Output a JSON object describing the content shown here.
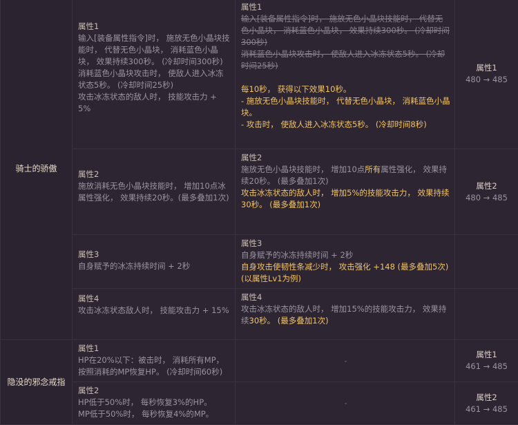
{
  "rings": [
    {
      "name": "骑士的骄傲",
      "attrs": [
        {
          "old_title": "属性1",
          "old_lines": [
            "输入[装备属性指令]时， 施放无色小晶块技能时， 代替无色小晶块， 消耗蓝色小晶块， 效果持续300秒。 (冷却时间300秒)",
            "消耗蓝色小晶块攻击时， 使敌人进入冰冻状态5秒。 (冷却时间25秒)",
            "攻击冰冻状态的敌人时， 技能攻击力 + 5%"
          ],
          "new_title": "属性1",
          "new_strike": [
            "输入[装备属性指令]时， 施放无色小晶块技能时， 代替无色小晶块， 消耗蓝色小晶块， 效果持续300秒。 (冷却时间300秒)",
            "消耗蓝色小晶块攻击时， 使敌人进入冰冻状态5秒。 (冷却时间25秒)"
          ],
          "new_hl": [
            "每10秒， 获得以下效果10秒。",
            "- 施放无色小晶块技能时， 代替无色小晶块， 消耗蓝色小晶块。",
            "- 攻击时， 使敌人进入冰冻状态5秒。 (冷却时间8秒)"
          ],
          "lv_title": "属性1",
          "lv_value": "480 → 485"
        },
        {
          "old_title": "属性2",
          "old_lines": [
            "施放消耗无色小晶块技能时， 增加10点冰属性强化， 效果持续20秒。(最多叠加1次)"
          ],
          "new_title": "属性2",
          "new_mixed_pre": "施放无色小晶块技能时， 增加10点",
          "new_mixed_hl": "所有",
          "new_mixed_post": "属性强化， 效果持续20秒。 (最多叠加1次)",
          "new_hl": [
            "攻击冰冻状态的敌人时， 增加5%的技能攻击力， 效果持续30秒。 (最多叠加1次)"
          ],
          "lv_title": "属性2",
          "lv_value": "480 → 485"
        },
        {
          "old_title": "属性3",
          "old_lines": [
            "自身赋予的冰冻持续时间 + 2秒"
          ],
          "new_title": "属性3",
          "new_plain": [
            "自身赋予的冰冻持续时间 + 2秒"
          ],
          "new_hl": [
            "自身攻击使韧性条减少时， 攻击强化 +148 (最多叠加5次) (以属性Lv1为例)"
          ]
        },
        {
          "old_title": "属性4",
          "old_lines": [
            "攻击冰冻状态敌人时， 技能攻击力 + 15%"
          ],
          "new_title": "属性4",
          "new_plain_pre": "攻击冰冻状态的敌人时， 增加15%的技能攻击力， 效果持续",
          "new_plain_hl": "30秒。 (最多叠加1次)"
        }
      ]
    },
    {
      "name": "隐没的邪念戒指",
      "attrs": [
        {
          "old_title": "属性1",
          "old_lines": [
            "HP在20%以下：被击时， 消耗所有MP，按照消耗的MP恢复HP。 (冷却时间60秒)"
          ],
          "new_empty": "-",
          "lv_title": "属性1",
          "lv_value": "461 → 485"
        },
        {
          "old_title": "属性2",
          "old_lines": [
            "HP低于50%时， 每秒恢复3%的HP。",
            "MP低于50%时， 每秒恢复4%的MP。"
          ],
          "new_empty": "-",
          "lv_title": "属性2",
          "lv_value": "461 → 485"
        }
      ]
    }
  ]
}
